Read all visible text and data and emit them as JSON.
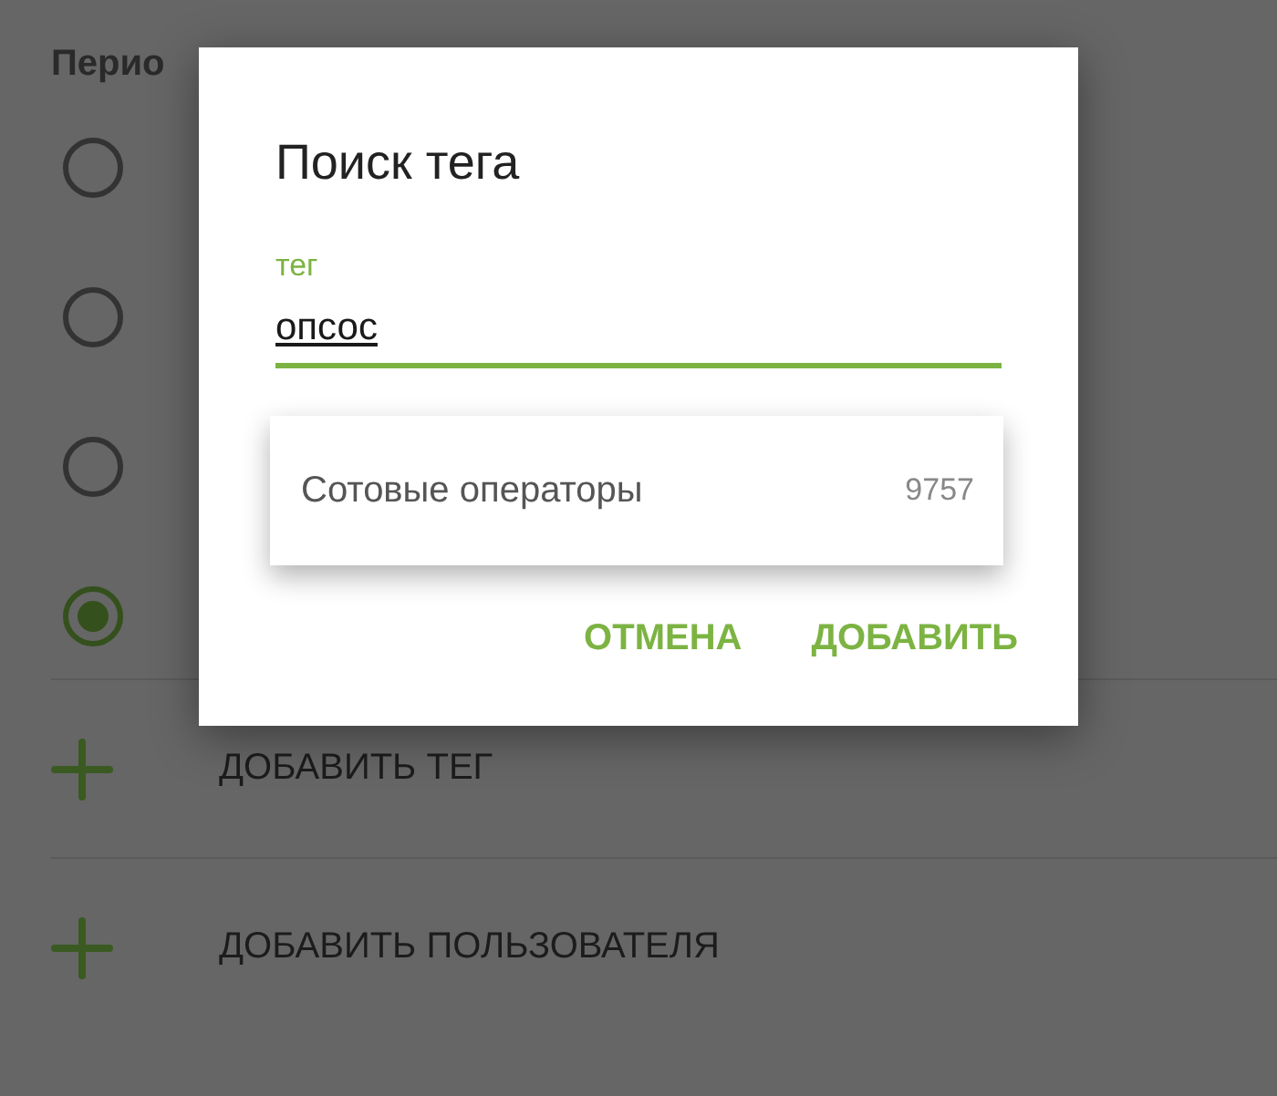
{
  "background": {
    "section_title": "Перио",
    "radios": [
      {
        "selected": false
      },
      {
        "selected": false
      },
      {
        "selected": false
      },
      {
        "selected": true
      }
    ],
    "actions": [
      {
        "label": "ДОБАВИТЬ ТЕГ"
      },
      {
        "label": "ДОБАВИТЬ ПОЛЬЗОВАТЕЛЯ"
      }
    ]
  },
  "dialog": {
    "title": "Поиск тега",
    "field": {
      "label": "тег",
      "value": "опсос"
    },
    "suggestions": [
      {
        "name": "Сотовые операторы",
        "count": "9757"
      }
    ],
    "buttons": [
      {
        "label": "ОТМЕНА"
      },
      {
        "label": "ДОБАВИТЬ"
      }
    ]
  }
}
